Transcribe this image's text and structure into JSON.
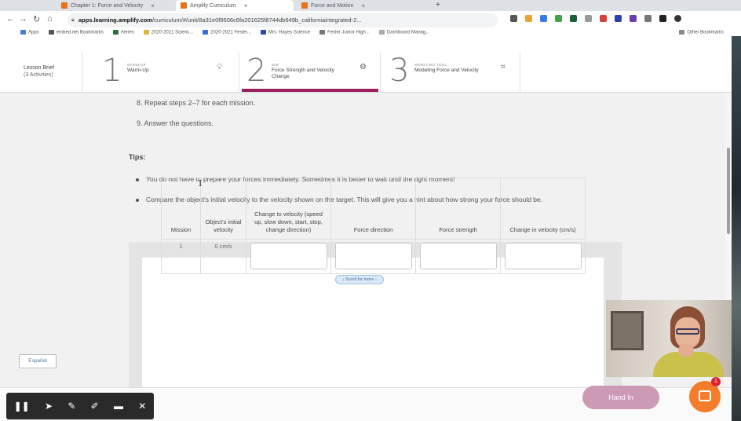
{
  "browser": {
    "tabs": [
      {
        "label": "Chapter 1: Force and Velocity"
      },
      {
        "label": "Amplify Curriculum"
      },
      {
        "label": "Force and Motion"
      }
    ],
    "url_host": "apps.learning.amplify.com",
    "url_path": "/curriculum/#/unit/8a31e0f9506c6fa201625f8744db649b_californiaintegrated-2...",
    "bookmarks": [
      "Apps",
      "embed.net Bookmarks",
      "Aeries",
      "2020-2021 Scienc...",
      "2020-2021 Fesler...",
      "Mrs. Hayes Science",
      "Fesler Junior High...",
      "Dashboard Manag..."
    ],
    "other_bookmarks": "Other Bookmarks"
  },
  "header": {
    "lesson_brief": "Lesson Brief",
    "lesson_brief_sub": "(3 Activities)",
    "steps": [
      {
        "num": "1",
        "kicker": "WARM-UP",
        "title": "Warm-Up"
      },
      {
        "num": "2",
        "kicker": "SIM",
        "title": "Force Strength and Velocity Change"
      },
      {
        "num": "3",
        "kicker": "MODELING TOOL",
        "title": "Modeling Force and Velocity"
      }
    ]
  },
  "content": {
    "step8": "8. Repeat steps 2–7 for each mission.",
    "step9": "9. Answer the questions.",
    "tips_heading": "Tips:",
    "tips": [
      "You do not have to prepare your forces immediately. Sometimes it is better to wait until the right moment!",
      "Compare the object's initial velocity to the velocity shown on the target. This will give you a hint about how strong your force should be."
    ],
    "table": {
      "headers": [
        "Mission",
        "Object's initial velocity",
        "Change to velocity (speed up, slow down, start, stop, change direction)",
        "Force direction",
        "Force strength",
        "Change in velocity (cm/s)"
      ],
      "rows": [
        {
          "mission": "1",
          "initial_velocity": "0 cm/s"
        }
      ]
    },
    "scroll_more": "↓ Scroll for more ↓",
    "espanol": "Español"
  },
  "footer": {
    "hand_in": "Hand In",
    "chat_badge": "1"
  }
}
